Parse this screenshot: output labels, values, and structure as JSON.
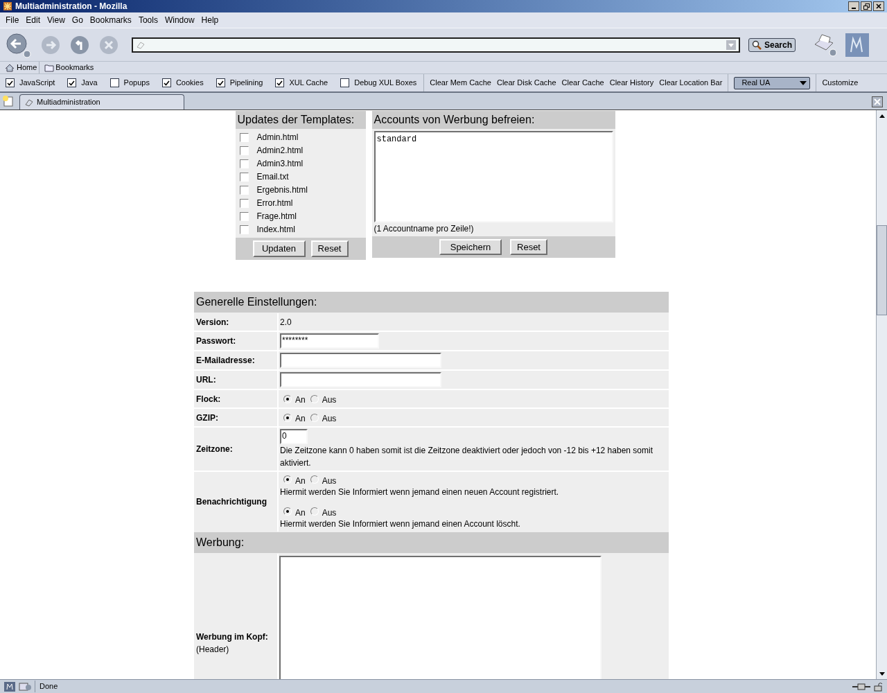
{
  "window": {
    "title": "Multiadministration - Mozilla"
  },
  "menu": [
    "File",
    "Edit",
    "View",
    "Go",
    "Bookmarks",
    "Tools",
    "Window",
    "Help"
  ],
  "navigation": {
    "search_button": "Search"
  },
  "personal_bar": [
    "Home",
    "Bookmarks"
  ],
  "pref_bar": {
    "checks": [
      {
        "label": "JavaScript",
        "checked": true
      },
      {
        "label": "Java",
        "checked": true
      },
      {
        "label": "Popups",
        "checked": false
      },
      {
        "label": "Cookies",
        "checked": true
      },
      {
        "label": "Pipelining",
        "checked": true
      },
      {
        "label": "XUL Cache",
        "checked": true
      },
      {
        "label": "Debug XUL Boxes",
        "checked": false
      }
    ],
    "buttons": [
      "Clear Mem Cache",
      "Clear Disk Cache",
      "Clear Cache",
      "Clear History",
      "Clear Location Bar"
    ],
    "ua_select": "Real UA",
    "customize": "Customize"
  },
  "tabs": [
    {
      "label": "Multiadministration",
      "selected": true
    }
  ],
  "templates": {
    "title": "Updates der Templates:",
    "files": [
      {
        "label": "Admin.html",
        "checked": false
      },
      {
        "label": "Admin2.html",
        "checked": false
      },
      {
        "label": "Admin3.html",
        "checked": false
      },
      {
        "label": "Email.txt",
        "checked": false
      },
      {
        "label": "Ergebnis.html",
        "checked": false
      },
      {
        "label": "Error.html",
        "checked": false
      },
      {
        "label": "Frage.html",
        "checked": false
      },
      {
        "label": "Index.html",
        "checked": false
      }
    ],
    "buttons": [
      "Updaten",
      "Reset"
    ]
  },
  "accounts": {
    "title": "Accounts von Werbung befreien:",
    "value": "standard",
    "hint": "(1 Accountname pro Zeile!)",
    "buttons": [
      "Speichern",
      "Reset"
    ]
  },
  "general": {
    "title": "Generelle Einstellungen:",
    "rows": [
      {
        "kind": "text",
        "label": "Version:",
        "value": "2.0"
      },
      {
        "kind": "field",
        "label": "Passwort:",
        "value": "********"
      },
      {
        "kind": "field",
        "label": "E-Mailadresse:",
        "value": ""
      },
      {
        "kind": "field",
        "label": "URL:",
        "value": ""
      },
      {
        "kind": "radio",
        "label": "Flock:",
        "groups": [
          {
            "options": [
              {
                "label": "An",
                "selected": true
              },
              {
                "label": "Aus",
                "selected": false
              }
            ]
          }
        ]
      },
      {
        "kind": "radio",
        "label": "GZIP:",
        "groups": [
          {
            "options": [
              {
                "label": "An",
                "selected": true
              },
              {
                "label": "Aus",
                "selected": false
              }
            ]
          }
        ]
      },
      {
        "kind": "field",
        "label": "Zeitzone:",
        "value": "0",
        "note": "Die Zeitzone kann 0 haben somit ist die Zeitzone deaktiviert oder jedoch von -12 bis +12 haben somit aktiviert."
      },
      {
        "kind": "radio",
        "label": "Benachrichtigung",
        "groups": [
          {
            "options": [
              {
                "label": "An",
                "selected": true
              },
              {
                "label": "Aus",
                "selected": false
              }
            ],
            "note": "Hiermit werden Sie Informiert wenn jemand einen neuen Account registriert."
          },
          {
            "options": [
              {
                "label": "An",
                "selected": true
              },
              {
                "label": "Aus",
                "selected": false
              }
            ],
            "note": "Hiermit werden Sie Informiert wenn jemand einen Account löscht."
          }
        ]
      }
    ]
  },
  "ads": {
    "title": "Werbung:",
    "label": "Werbung im Kopf:",
    "sublabel": "(Header)"
  },
  "status_bar": {
    "text": "Done"
  }
}
